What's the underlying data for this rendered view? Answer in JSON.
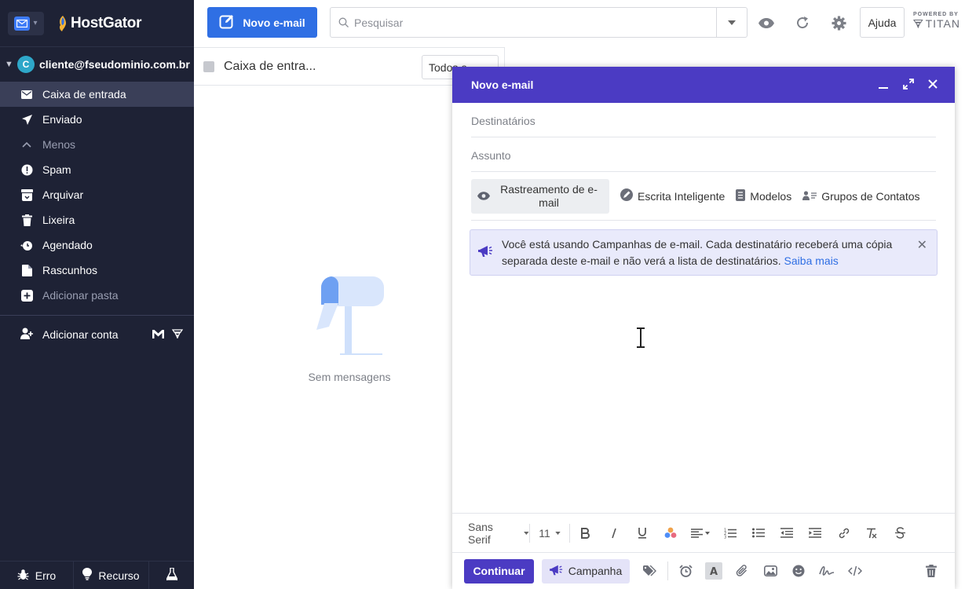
{
  "brand": {
    "name": "HostGator"
  },
  "account": {
    "initial": "C",
    "email": "cliente@fseudominio.com.br"
  },
  "folders": [
    {
      "label": "Caixa de entrada",
      "icon": "inbox-icon"
    },
    {
      "label": "Enviado",
      "icon": "send-icon"
    },
    {
      "label": "Menos",
      "icon": "chevron-up-icon"
    },
    {
      "label": "Spam",
      "icon": "spam-icon"
    },
    {
      "label": "Arquivar",
      "icon": "archive-icon"
    },
    {
      "label": "Lixeira",
      "icon": "trash-icon"
    },
    {
      "label": "Agendado",
      "icon": "schedule-icon"
    },
    {
      "label": "Rascunhos",
      "icon": "drafts-icon"
    },
    {
      "label": "Adicionar pasta",
      "icon": "add-folder-icon"
    }
  ],
  "add_account": "Adicionar conta",
  "bottom": {
    "error": "Erro",
    "feature": "Recurso"
  },
  "topbar": {
    "compose_label": "Novo e-mail",
    "search_placeholder": "Pesquisar",
    "help_label": "Ajuda",
    "powered_by": "POWERED BY",
    "powered_brand": "TITAN"
  },
  "list": {
    "title": "Caixa de entra...",
    "filter": "Todos e",
    "empty_text": "Sem mensagens"
  },
  "compose": {
    "title": "Novo e-mail",
    "to_placeholder": "Destinatários",
    "subject_placeholder": "Assunto",
    "tools": {
      "tracking": "Rastreamento de e-mail",
      "smart_write": "Escrita Inteligente",
      "templates": "Modelos",
      "contact_groups": "Grupos de Contatos"
    },
    "notice": {
      "text": "Você está usando Campanhas de e-mail. Cada destinatário receberá uma cópia separada deste e-mail e não verá a lista de destinatários.",
      "link": "Saiba mais"
    },
    "format": {
      "font": "Sans Serif",
      "size": "11"
    },
    "actions": {
      "continue": "Continuar",
      "campaign": "Campanha"
    }
  },
  "colors": {
    "sidebar_bg": "#1e2235",
    "primary": "#2f6fe4",
    "compose_header": "#4b3bc3"
  }
}
